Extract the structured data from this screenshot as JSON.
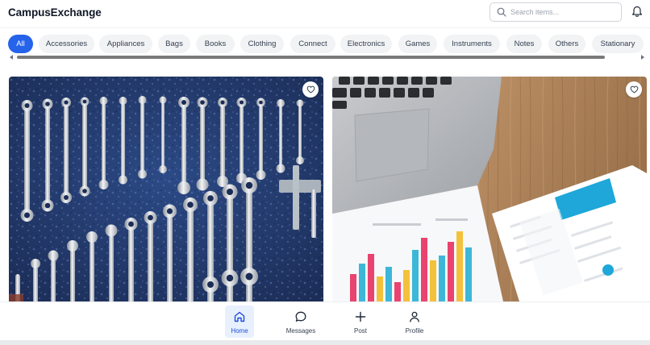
{
  "app": {
    "brand": "CampusExchange"
  },
  "search": {
    "placeholder": "Search items..."
  },
  "header": {
    "notification_icon": "bell-icon"
  },
  "categories": [
    {
      "label": "All",
      "active": true
    },
    {
      "label": "Accessories"
    },
    {
      "label": "Appliances"
    },
    {
      "label": "Bags"
    },
    {
      "label": "Books"
    },
    {
      "label": "Clothing"
    },
    {
      "label": "Connect"
    },
    {
      "label": "Electronics"
    },
    {
      "label": "Games"
    },
    {
      "label": "Instruments"
    },
    {
      "label": "Notes"
    },
    {
      "label": "Others"
    },
    {
      "label": "Stationary"
    }
  ],
  "listings": [
    {
      "image": "wrench-set-photo",
      "favorite_icon": "heart-icon"
    },
    {
      "image": "laptop-and-charts-photo",
      "favorite_icon": "heart-icon"
    }
  ],
  "bottom_nav": [
    {
      "label": "Home",
      "icon": "home-icon",
      "active": true
    },
    {
      "label": "Messages",
      "icon": "message-icon"
    },
    {
      "label": "Post",
      "icon": "plus-icon"
    },
    {
      "label": "Profile",
      "icon": "user-icon"
    }
  ],
  "colors": {
    "accent": "#2563eb",
    "chip_bg": "#f1f3f5",
    "nav_active_bg": "#e8f0fe"
  }
}
